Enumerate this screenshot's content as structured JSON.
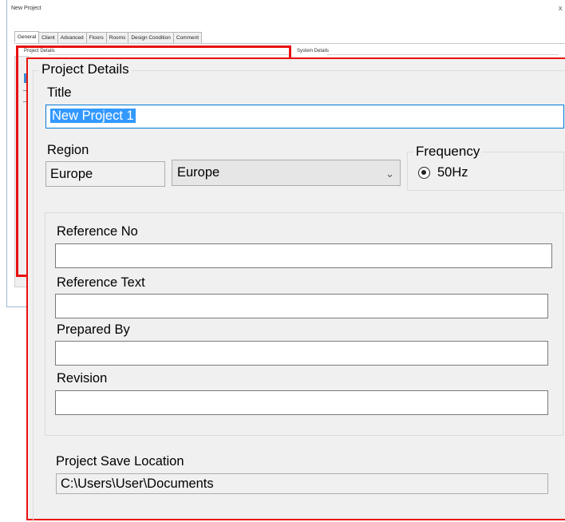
{
  "window": {
    "title": "New Project",
    "close_glyph": "x"
  },
  "tabs": [
    {
      "label": "General",
      "active": true
    },
    {
      "label": "Client"
    },
    {
      "label": "Advanced"
    },
    {
      "label": "Floors"
    },
    {
      "label": "Rooms"
    },
    {
      "label": "Design Condition"
    },
    {
      "label": "Comment"
    }
  ],
  "small_groups": {
    "project_details": "Project Details",
    "system_details": "System Details"
  },
  "project_details": {
    "group_title": "Project Details",
    "title_label": "Title",
    "title_value": "New Project 1",
    "region_label": "Region",
    "region_value": "Europe",
    "region_select": "Europe",
    "frequency_label": "Frequency",
    "frequency_option": "50Hz",
    "reference_no_label": "Reference No",
    "reference_no_value": "",
    "reference_text_label": "Reference Text",
    "reference_text_value": "",
    "prepared_by_label": "Prepared By",
    "prepared_by_value": "",
    "revision_label": "Revision",
    "revision_value": "",
    "save_location_label": "Project Save Location",
    "save_location_value": "C:\\Users\\User\\Documents"
  },
  "colors": {
    "callout": "#e81010",
    "selection": "#3399ff",
    "dialog_bg": "#f0f0f0"
  }
}
